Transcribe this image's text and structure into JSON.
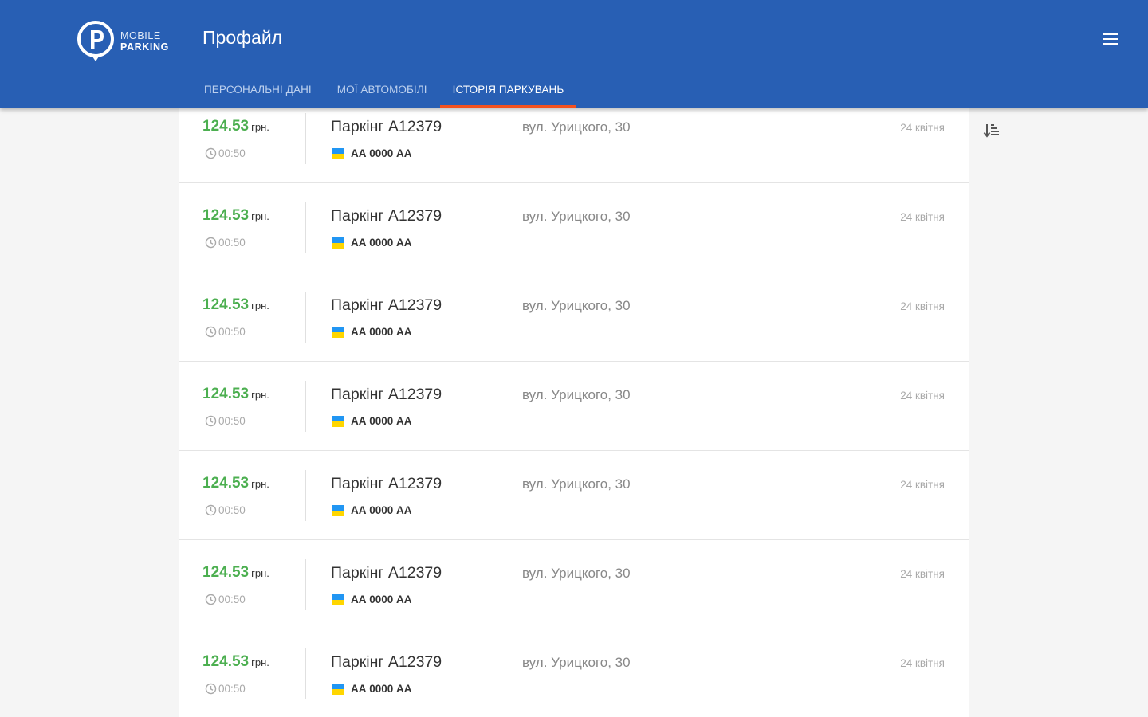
{
  "header": {
    "logo": {
      "line1": "MOBILE",
      "line2": "PARKING",
      "icon": "parking-pin-logo"
    },
    "title": "Профайл",
    "menu_icon": "hamburger-menu-icon"
  },
  "tabs": [
    {
      "label": "ПЕРСОНАЛЬНІ ДАНІ",
      "active": false
    },
    {
      "label": "МОЇ АВТОМОБІЛІ",
      "active": false
    },
    {
      "label": "ІСТОРІЯ ПАРКУВАНЬ",
      "active": true
    }
  ],
  "sort_icon": "sort-descending-icon",
  "history": [
    {
      "price": "124.53",
      "unit": "грн.",
      "duration": "00:50",
      "parking": "Паркінг А12379",
      "plate": "АА 0000 АА",
      "address": "вул. Урицкого, 30",
      "date": "24 квітня"
    },
    {
      "price": "124.53",
      "unit": "грн.",
      "duration": "00:50",
      "parking": "Паркінг А12379",
      "plate": "АА 0000 АА",
      "address": "вул. Урицкого, 30",
      "date": "24 квітня"
    },
    {
      "price": "124.53",
      "unit": "грн.",
      "duration": "00:50",
      "parking": "Паркінг А12379",
      "plate": "АА 0000 АА",
      "address": "вул. Урицкого, 30",
      "date": "24 квітня"
    },
    {
      "price": "124.53",
      "unit": "грн.",
      "duration": "00:50",
      "parking": "Паркінг А12379",
      "plate": "АА 0000 АА",
      "address": "вул. Урицкого, 30",
      "date": "24 квітня"
    },
    {
      "price": "124.53",
      "unit": "грн.",
      "duration": "00:50",
      "parking": "Паркінг А12379",
      "plate": "АА 0000 АА",
      "address": "вул. Урицкого, 30",
      "date": "24 квітня"
    },
    {
      "price": "124.53",
      "unit": "грн.",
      "duration": "00:50",
      "parking": "Паркінг А12379",
      "plate": "АА 0000 АА",
      "address": "вул. Урицкого, 30",
      "date": "24 квітня"
    },
    {
      "price": "124.53",
      "unit": "грн.",
      "duration": "00:50",
      "parking": "Паркінг А12379",
      "plate": "АА 0000 АА",
      "address": "вул. Урицкого, 30",
      "date": "24 квітня"
    }
  ],
  "colors": {
    "header": "#285fb4",
    "accent": "#f4511e",
    "price": "#4caf50"
  }
}
